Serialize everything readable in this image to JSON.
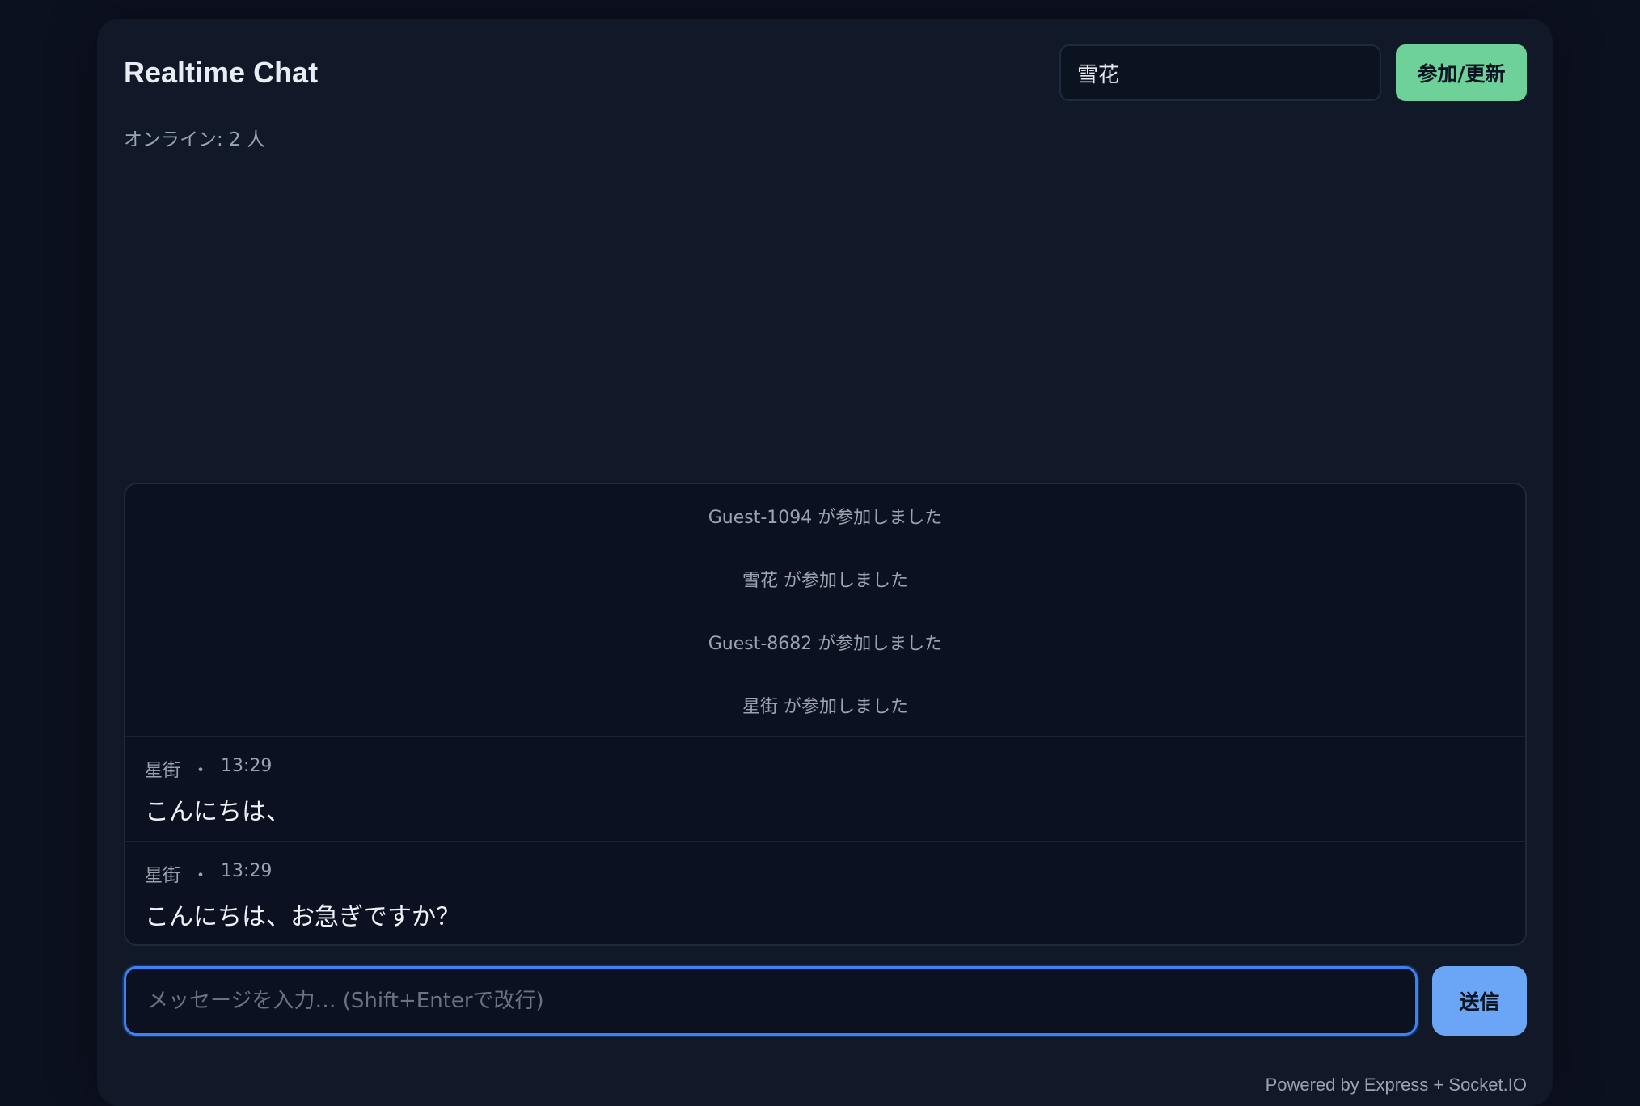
{
  "header": {
    "title": "Realtime Chat",
    "name_value": "雪花",
    "join_button": "参加/更新"
  },
  "status": {
    "online_text": "オンライン: 2 人"
  },
  "messages": {
    "system": [
      "Guest-1094 が参加しました",
      "雪花 が参加しました",
      "Guest-8682 が参加しました",
      "星街 が参加しました"
    ],
    "chat": [
      {
        "author": "星街",
        "separator": "・",
        "time": "13:29",
        "text": "こんにちは、"
      },
      {
        "author": "星街",
        "separator": "・",
        "time": "13:29",
        "text": "こんにちは、お急ぎですか？"
      }
    ]
  },
  "composer": {
    "placeholder": "メッセージを入力… (Shift+Enterで改行)",
    "send_button": "送信"
  },
  "footer": {
    "text": "Powered by Express + Socket.IO"
  },
  "colors": {
    "background": "#0c1120",
    "panel": "#111827",
    "join_button": "#6ed19a",
    "send_button": "#6aa6f5",
    "focus_border": "#3b82f6"
  }
}
